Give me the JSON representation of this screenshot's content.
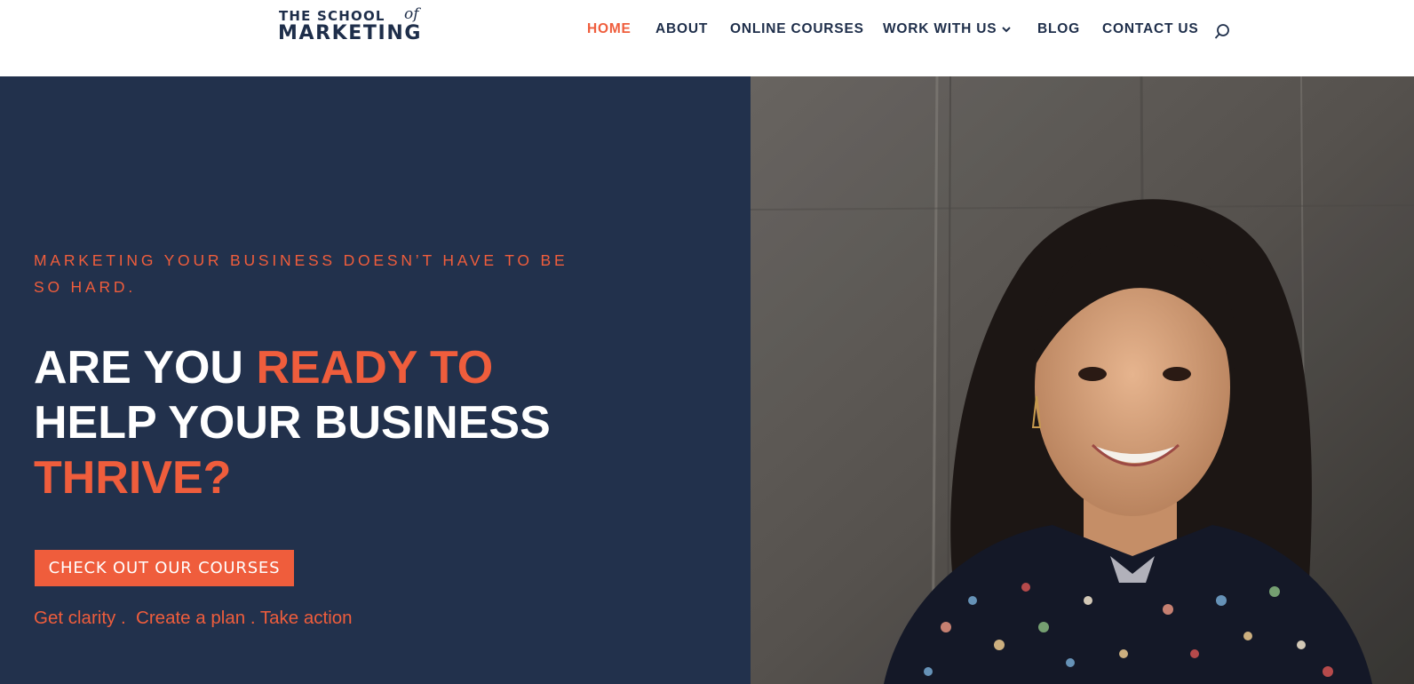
{
  "brand": {
    "line1": "THE SCHOOL",
    "of": "of",
    "line2": "MARKETING",
    "color": "#1e2e4a"
  },
  "nav": {
    "items": [
      {
        "label": "HOME",
        "active": true
      },
      {
        "label": "ABOUT"
      },
      {
        "label": "ONLINE COURSES"
      },
      {
        "label": "WORK WITH US",
        "has_dropdown": true
      },
      {
        "label": "BLOG"
      },
      {
        "label": "CONTACT US"
      }
    ],
    "search_icon": "search-icon"
  },
  "hero": {
    "kicker": "MARKETING YOUR BUSINESS DOESN’T HAVE TO BE SO HARD.",
    "headline": {
      "part1": "ARE YOU ",
      "part2": "READY TO",
      "part3": "HELP YOUR BUSINESS",
      "part4": "THRIVE?"
    },
    "cta_label": "CHECK OUT OUR COURSES",
    "tagline": "Get clarity .  Create a plan . Take action"
  },
  "colors": {
    "accent": "#ef5d3c",
    "navy": "#22314c",
    "nav_text": "#1e2e4a"
  }
}
